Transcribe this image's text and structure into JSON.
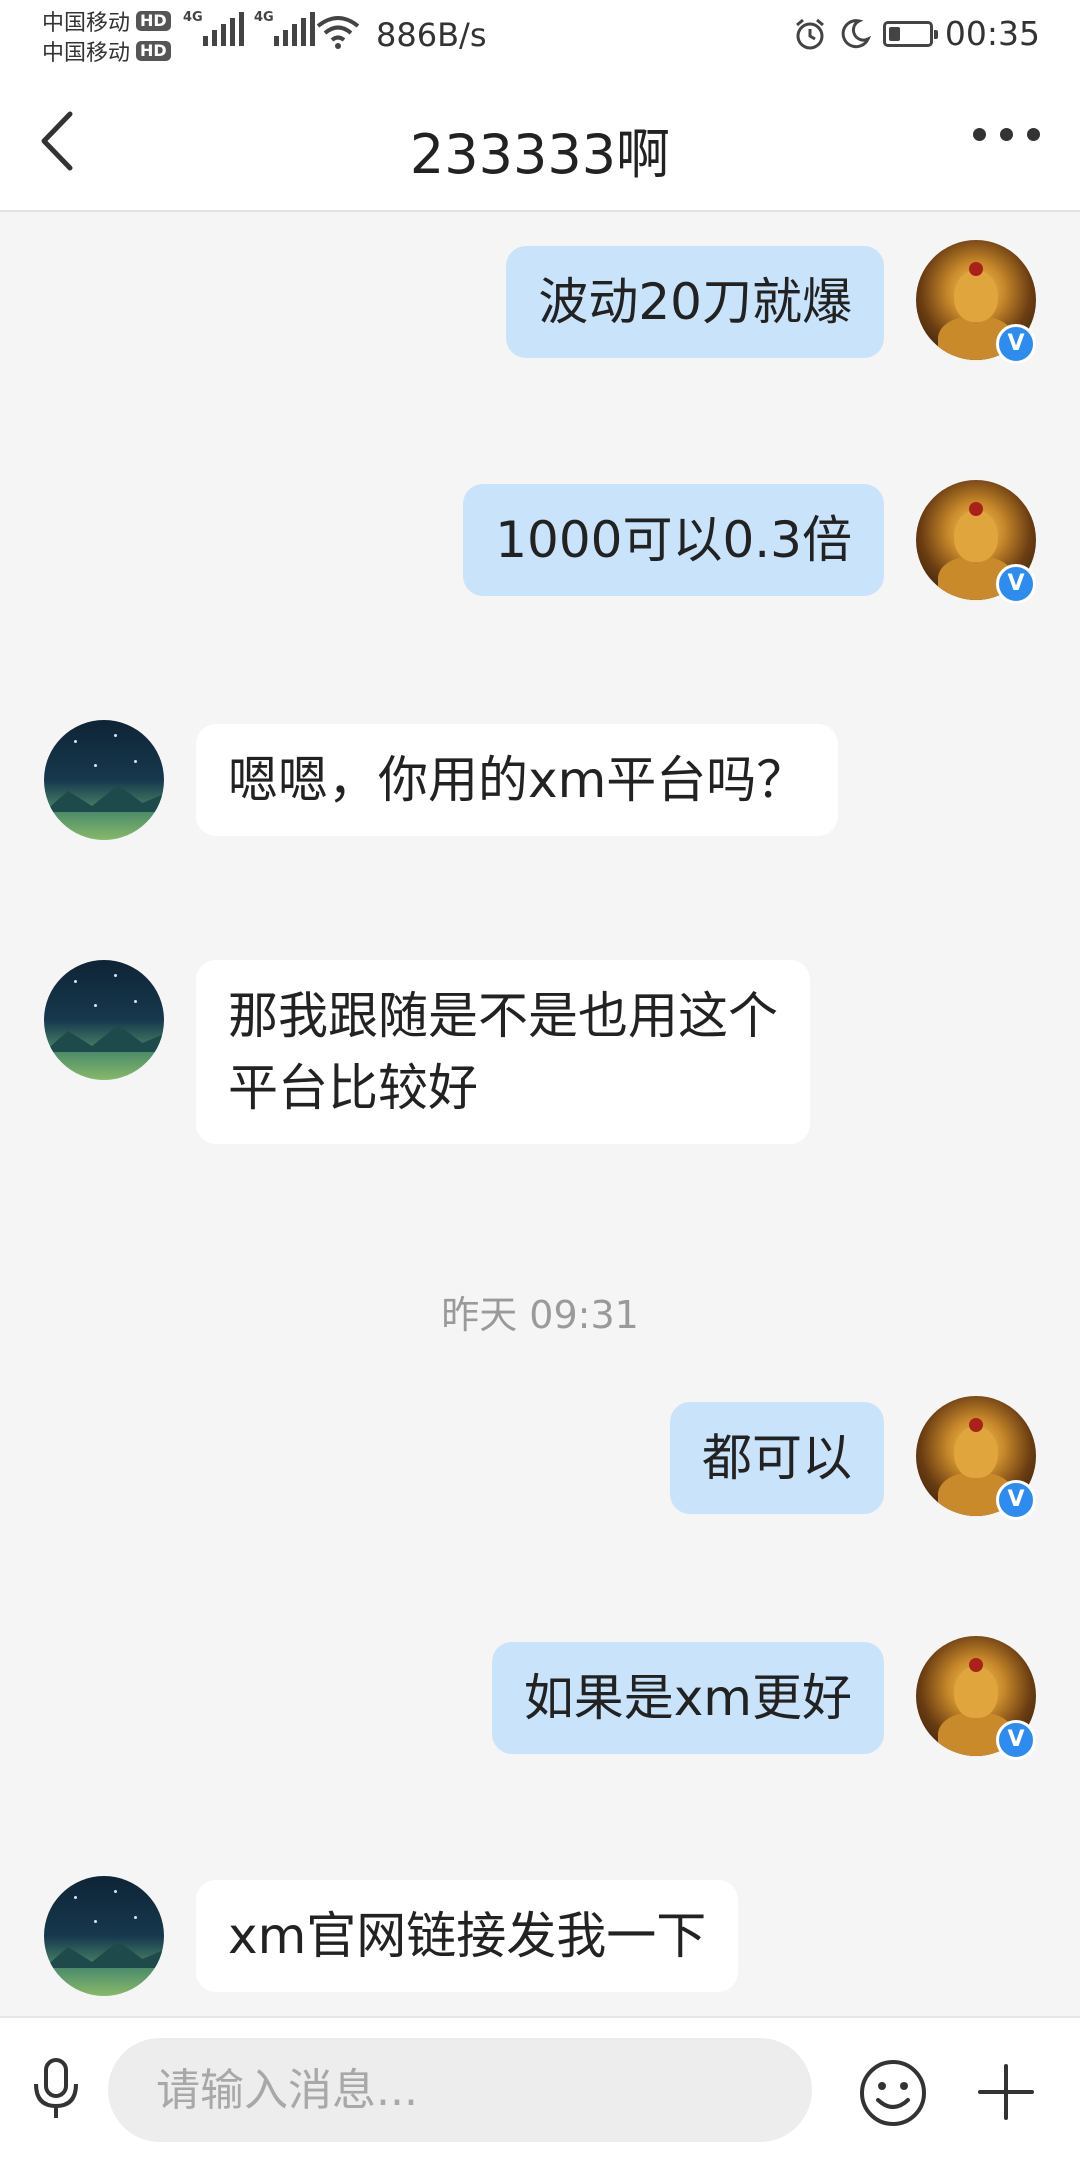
{
  "status_bar": {
    "carrier_1": "中国移动",
    "carrier_2": "中国移动",
    "hd_badge": "HD",
    "network_tag": "4G",
    "net_speed": "886B/s",
    "time": "00:35",
    "battery_level": 0.3,
    "icons": [
      "signal-icon",
      "wifi-icon",
      "alarm-icon",
      "moon-icon",
      "battery-icon"
    ]
  },
  "header": {
    "title": "233333啊",
    "back_icon": "chevron-left-icon",
    "more_icon": "more-dots-icon"
  },
  "messages": [
    {
      "sender": "me",
      "text": "波动20刀就爆"
    },
    {
      "sender": "me",
      "text": "1000可以0.3倍"
    },
    {
      "sender": "them",
      "text": "嗯嗯，你用的xm平台吗？"
    },
    {
      "sender": "them",
      "text_line_1": "那我跟随是不是也用这个",
      "text_line_2": "平台比较好"
    },
    {
      "type": "timestamp",
      "text": "昨天 09:31"
    },
    {
      "sender": "me",
      "text": "都可以"
    },
    {
      "sender": "me",
      "text": "如果是xm更好"
    },
    {
      "sender": "them",
      "text": "xm官网链接发我一下"
    }
  ],
  "verified_badge": "V",
  "input": {
    "placeholder": "请输入消息...",
    "value": ""
  },
  "colors": {
    "my_bubble": "#c9e3fa",
    "their_bubble": "#ffffff",
    "background": "#f5f5f5",
    "verified_blue": "#2d8cf0"
  }
}
